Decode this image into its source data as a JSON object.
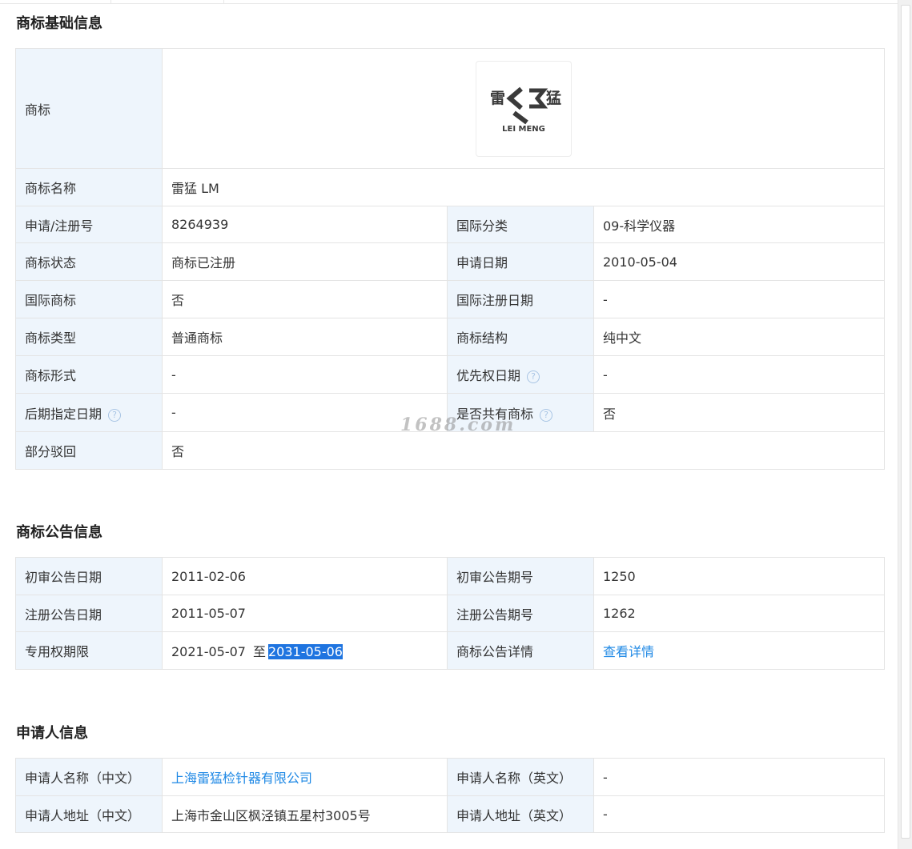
{
  "sections": {
    "basic": {
      "title": "商标基础信息",
      "trademark": {
        "label": "商标",
        "logo": {
          "char_left": "雷",
          "char_right": "猛",
          "subtitle": "LEI MENG"
        }
      },
      "name": {
        "label": "商标名称",
        "value": "雷猛 LM"
      },
      "reg_no": {
        "label": "申请/注册号",
        "value": "8264939"
      },
      "intl_class": {
        "label": "国际分类",
        "value": "09-科学仪器"
      },
      "status": {
        "label": "商标状态",
        "value": "商标已注册"
      },
      "apply_date": {
        "label": "申请日期",
        "value": "2010-05-04"
      },
      "intl_mark": {
        "label": "国际商标",
        "value": "否"
      },
      "intl_reg_date": {
        "label": "国际注册日期",
        "value": "-"
      },
      "type": {
        "label": "商标类型",
        "value": "普通商标"
      },
      "structure": {
        "label": "商标结构",
        "value": "纯中文"
      },
      "form": {
        "label": "商标形式",
        "value": "-"
      },
      "priority_date": {
        "label": "优先权日期",
        "value": "-"
      },
      "later_designation": {
        "label": "后期指定日期",
        "value": "-"
      },
      "shared": {
        "label": "是否共有商标",
        "value": "否"
      },
      "partial_reject": {
        "label": "部分驳回",
        "value": "否"
      }
    },
    "announcement": {
      "title": "商标公告信息",
      "prelim_date": {
        "label": "初审公告日期",
        "value": "2011-02-06"
      },
      "prelim_issue": {
        "label": "初审公告期号",
        "value": "1250"
      },
      "reg_date": {
        "label": "注册公告日期",
        "value": "2011-05-07"
      },
      "reg_issue": {
        "label": "注册公告期号",
        "value": "1262"
      },
      "exclusive_period": {
        "label": "专用权期限",
        "start": "2021-05-07",
        "sep": "至",
        "end": "2031-05-06"
      },
      "detail": {
        "label": "商标公告详情",
        "link": "查看详情"
      }
    },
    "applicant": {
      "title": "申请人信息",
      "name_cn": {
        "label": "申请人名称（中文）",
        "value": "上海雷猛检针器有限公司"
      },
      "name_en": {
        "label": "申请人名称（英文）",
        "value": "-"
      },
      "addr_cn": {
        "label": "申请人地址（中文）",
        "value": "上海市金山区枫泾镇五星村3005号"
      },
      "addr_en": {
        "label": "申请人地址（英文）",
        "value": "-"
      }
    }
  },
  "watermark": "1688.com",
  "help_icon_glyph": "?",
  "colors": {
    "label_bg": "#eef5fc",
    "link": "#1e88e5",
    "selection": "#1e74e0"
  }
}
